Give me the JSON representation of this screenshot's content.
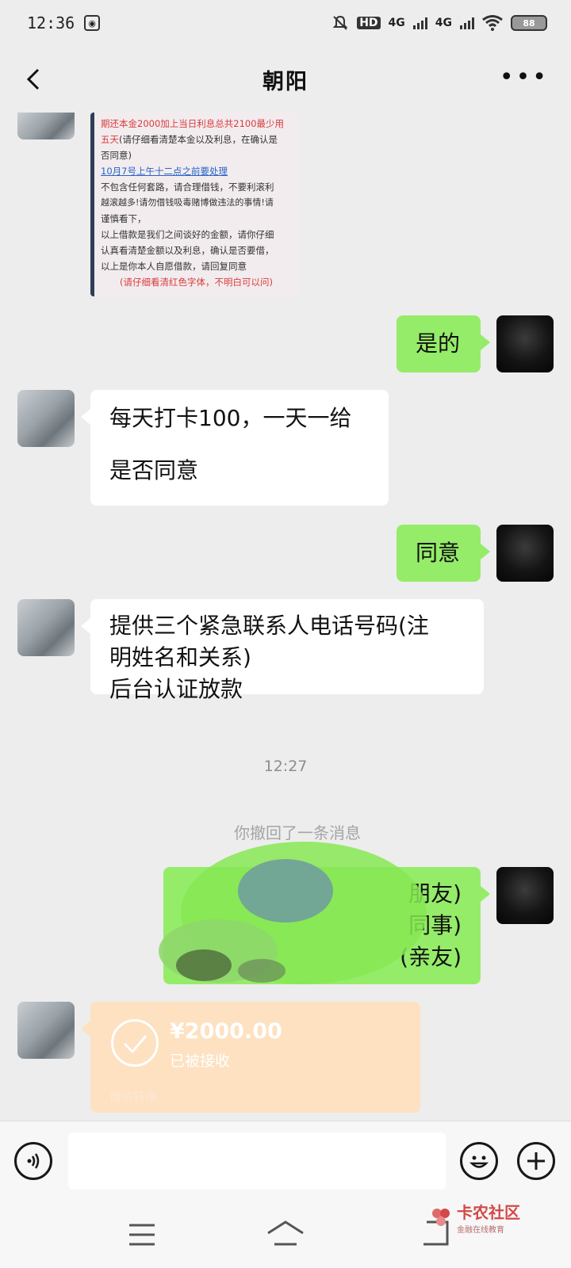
{
  "status_bar": {
    "time": "12:36",
    "network_1": "4G",
    "network_2": "4G",
    "hd_label": "HD",
    "battery": "88"
  },
  "header": {
    "title": "朝阳"
  },
  "image_message": {
    "lines": [
      {
        "text": "期还本金2000加上当日利息总共2100最少用",
        "color": "red"
      },
      {
        "text": "五天",
        "color": "red",
        "suffix": "(请仔细看清楚本金以及利息，在确认是"
      },
      {
        "text": "否同意)",
        "color": "normal"
      },
      {
        "text": "10月7号上午十二点之前要处理",
        "color": "blue"
      },
      {
        "text": "不包含任何套路，请合理借钱，不要利滚利",
        "color": "normal"
      },
      {
        "text": "越滚越多!请勿借钱吸毒赌博做违法的事情!请",
        "color": "normal"
      },
      {
        "text": "谨慎看下，",
        "color": "normal"
      },
      {
        "text": "以上借款是我们之间谈好的金额，请你仔细",
        "color": "normal"
      },
      {
        "text": "认真看清楚金额以及利息，确认是否要借，",
        "color": "normal"
      },
      {
        "text": "以上是你本人自愿借款，请回复同意",
        "color": "normal"
      },
      {
        "text": "(请仔细看清红色字体，不明白可以问)",
        "color": "red"
      }
    ]
  },
  "messages": [
    {
      "id": "m1",
      "direction": "out",
      "lines": [
        "是的"
      ]
    },
    {
      "id": "m2",
      "direction": "in",
      "lines": [
        "每天打卡100，一天一给",
        "",
        "是否同意"
      ]
    },
    {
      "id": "m3",
      "direction": "out",
      "lines": [
        "同意"
      ]
    },
    {
      "id": "m4",
      "direction": "in",
      "lines": [
        "提供三个紧急联系人电话号码(注",
        "明姓名和关系)",
        "后台认证放款"
      ]
    },
    {
      "id": "m5",
      "direction": "out",
      "lines": [
        "朋友)",
        "同事)",
        "(亲友)"
      ]
    }
  ],
  "time_separator": "12:27",
  "recall_notice": "你撤回了一条消息",
  "transfer": {
    "amount": "¥2000.00",
    "status": "已被接收",
    "footer": "微信转账"
  },
  "input_bar": {
    "placeholder": ""
  },
  "watermark": {
    "title": "卡农社区",
    "subtitle": "金融在线教育"
  },
  "colors": {
    "chat_bg": "#ededed",
    "bubble_out": "#95ec69",
    "bubble_in": "#ffffff",
    "transfer_bg": "#fde1c1"
  }
}
